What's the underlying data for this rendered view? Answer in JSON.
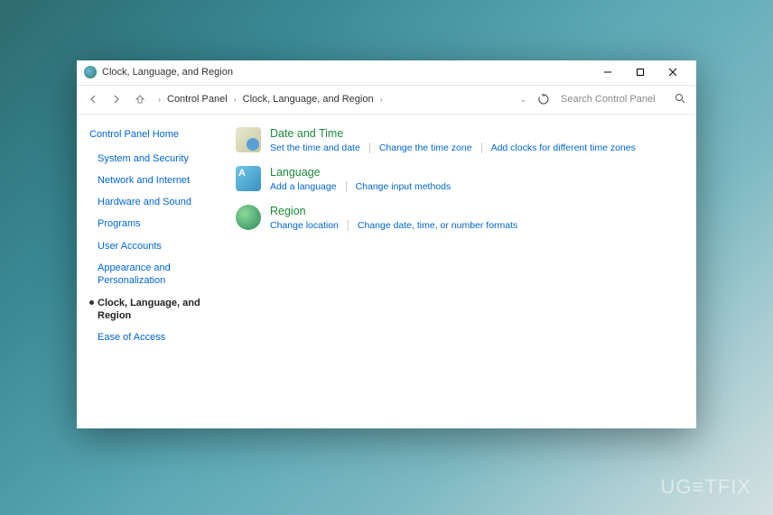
{
  "watermark": "UG≡TFIX",
  "titlebar": {
    "title": "Clock, Language, and Region"
  },
  "breadcrumb": {
    "items": [
      "Control Panel",
      "Clock, Language, and Region"
    ]
  },
  "search": {
    "placeholder": "Search Control Panel"
  },
  "sidebar": {
    "home": "Control Panel Home",
    "items": [
      {
        "label": "System and Security",
        "active": false
      },
      {
        "label": "Network and Internet",
        "active": false
      },
      {
        "label": "Hardware and Sound",
        "active": false
      },
      {
        "label": "Programs",
        "active": false
      },
      {
        "label": "User Accounts",
        "active": false
      },
      {
        "label": "Appearance and Personalization",
        "active": false
      },
      {
        "label": "Clock, Language, and Region",
        "active": true
      },
      {
        "label": "Ease of Access",
        "active": false
      }
    ]
  },
  "categories": [
    {
      "icon": "datetime",
      "title": "Date and Time",
      "links": [
        "Set the time and date",
        "Change the time zone",
        "Add clocks for different time zones"
      ]
    },
    {
      "icon": "language",
      "title": "Language",
      "links": [
        "Add a language",
        "Change input methods"
      ]
    },
    {
      "icon": "region",
      "title": "Region",
      "links": [
        "Change location",
        "Change date, time, or number formats"
      ]
    }
  ]
}
